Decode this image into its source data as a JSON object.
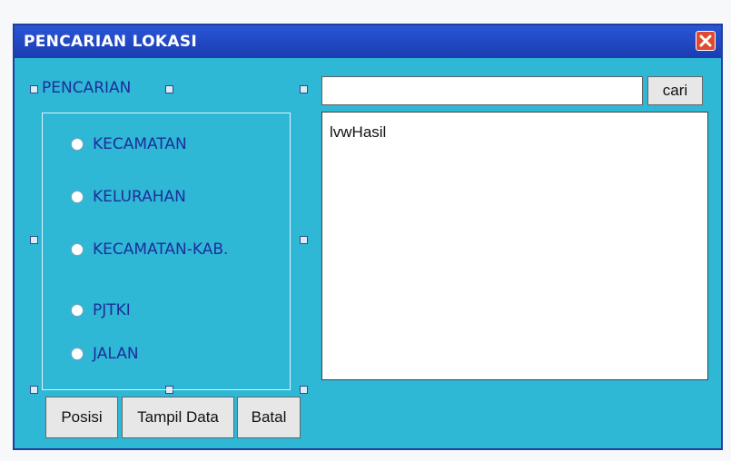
{
  "window": {
    "title": "PENCARIAN LOKASI",
    "close_icon": "close-icon"
  },
  "search_frame": {
    "caption": "PENCARIAN",
    "options": [
      {
        "label": "KECAMATAN"
      },
      {
        "label": "KELURAHAN"
      },
      {
        "label": "KECAMATAN-KAB."
      },
      {
        "label": "PJTKI"
      },
      {
        "label": "JALAN"
      }
    ]
  },
  "search": {
    "value": "",
    "button_label": "cari"
  },
  "result_list": {
    "name": "lvwHasil"
  },
  "buttons": {
    "position_label": "Posisi",
    "show_data_label": "Tampil Data",
    "cancel_label": "Batal"
  },
  "colors": {
    "window_bg": "#2fb7d6",
    "titlebar": "#1a3cb2",
    "text_accent": "#1c2f9a",
    "close_button": "#e04b2f"
  }
}
